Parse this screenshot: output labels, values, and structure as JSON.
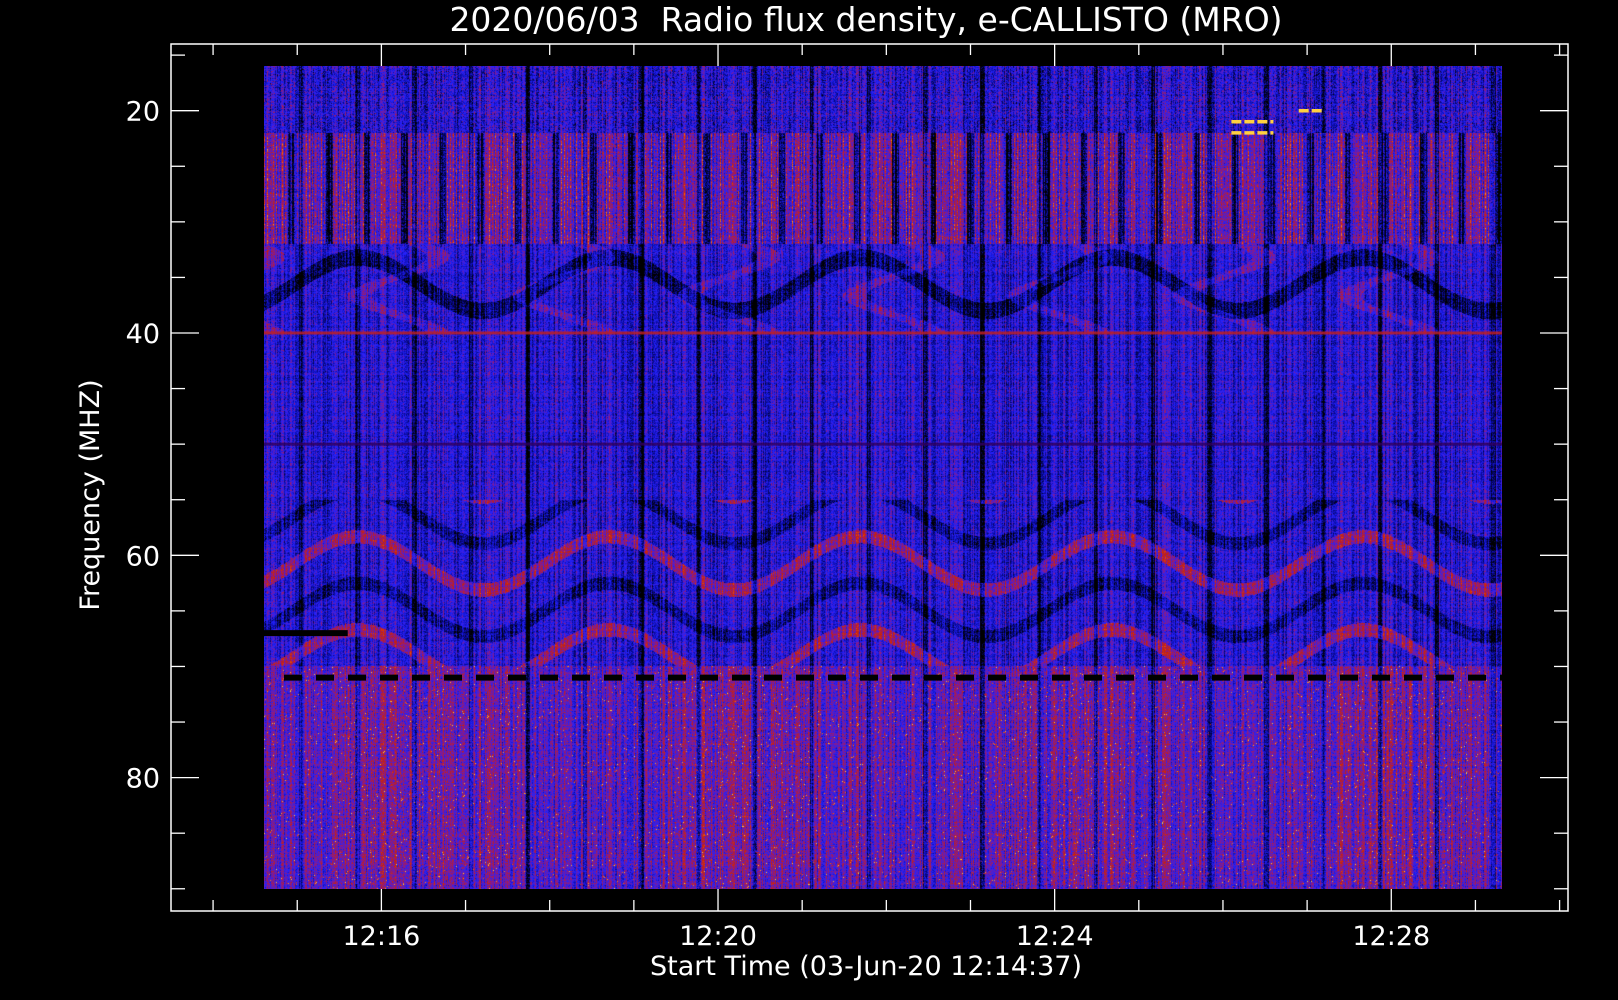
{
  "chart_data": {
    "type": "heatmap",
    "title": "2020/06/03  Radio flux density, e-CALLISTO (MRO)",
    "xlabel": "Start Time (03-Jun-20 12:14:37)",
    "ylabel": "Frequency (MHZ)",
    "x_ticks": [
      {
        "minute": 16,
        "label": "12:16"
      },
      {
        "minute": 20,
        "label": "12:20"
      },
      {
        "minute": 24,
        "label": "12:24"
      },
      {
        "minute": 28,
        "label": "12:28"
      }
    ],
    "y_ticks": [
      {
        "value": 20,
        "label": "20"
      },
      {
        "value": 40,
        "label": "40"
      },
      {
        "value": 60,
        "label": "60"
      },
      {
        "value": 80,
        "label": "80"
      }
    ],
    "xlim_minutes_after_12h": [
      13.5,
      30.1
    ],
    "data_x_range_minutes_after_12h": [
      14.6,
      29.6
    ],
    "ylim_mhz": [
      14,
      92
    ],
    "data_y_range_mhz": [
      16,
      90
    ],
    "y_inverted": true,
    "minor_x_step_minutes": 1,
    "minor_y_step_mhz": 5,
    "colormap": [
      "#000000",
      "#0a0a9a",
      "#2222ff",
      "#8a1a8a",
      "#cc2200",
      "#ff6600",
      "#ffd040"
    ],
    "features": [
      {
        "type": "interference_band",
        "freq_mhz": [
          22,
          32
        ],
        "intensity": "high"
      },
      {
        "type": "horizontal_line",
        "freq_mhz": 40,
        "color": "#c02020"
      },
      {
        "type": "horizontal_line",
        "freq_mhz": 50,
        "color": "#300060"
      },
      {
        "type": "dashed_dark_line",
        "freq_mhz": 71
      },
      {
        "type": "dark_segment",
        "freq_mhz": 67,
        "minutes": [
          14.6,
          15.6
        ]
      },
      {
        "type": "enhanced_emission",
        "freq_mhz": [
          70,
          90
        ],
        "intensity": "medium"
      },
      {
        "type": "bright_spot",
        "freq_mhz": 21,
        "minutes": [
          26.1,
          26.6
        ]
      },
      {
        "type": "bright_spot",
        "freq_mhz": 22,
        "minutes": [
          26.1,
          26.6
        ]
      },
      {
        "type": "bright_spot",
        "freq_mhz": 20,
        "minutes": [
          26.9,
          27.2
        ]
      }
    ]
  }
}
